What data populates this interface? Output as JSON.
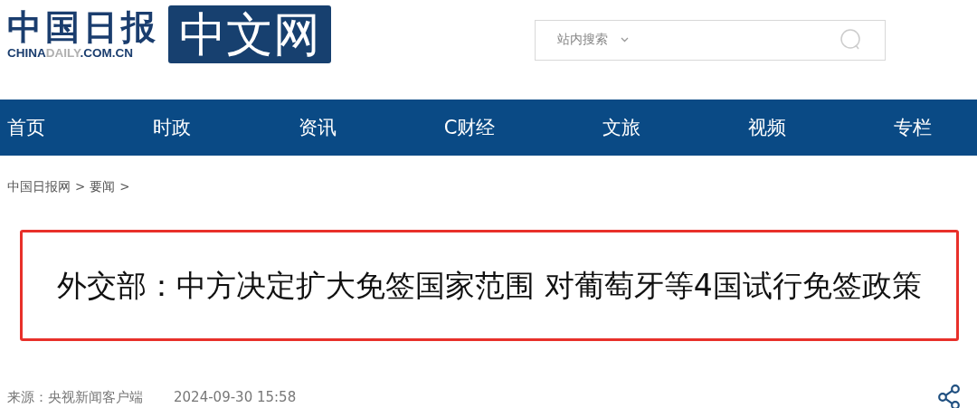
{
  "logo": {
    "calligraphy": "中国日报",
    "domain_prefix": "CHINA",
    "domain_highlight": "DAILY",
    "domain_suffix": ".COM.CN",
    "badge": "中文网"
  },
  "search": {
    "placeholder": "站内搜索"
  },
  "nav": [
    {
      "label": "首页"
    },
    {
      "label": "时政"
    },
    {
      "label": "资讯"
    },
    {
      "label": "C财经"
    },
    {
      "label": "文旅"
    },
    {
      "label": "视频"
    },
    {
      "label": "专栏"
    }
  ],
  "breadcrumb": {
    "items": [
      "中国日报网",
      "要闻"
    ],
    "separator": ">"
  },
  "headline": "外交部：中方决定扩大免签国家范围 对葡萄牙等4国试行免签政策",
  "meta": {
    "source": "来源：央视新闻客户端",
    "datetime": "2024-09-30 15:58"
  }
}
